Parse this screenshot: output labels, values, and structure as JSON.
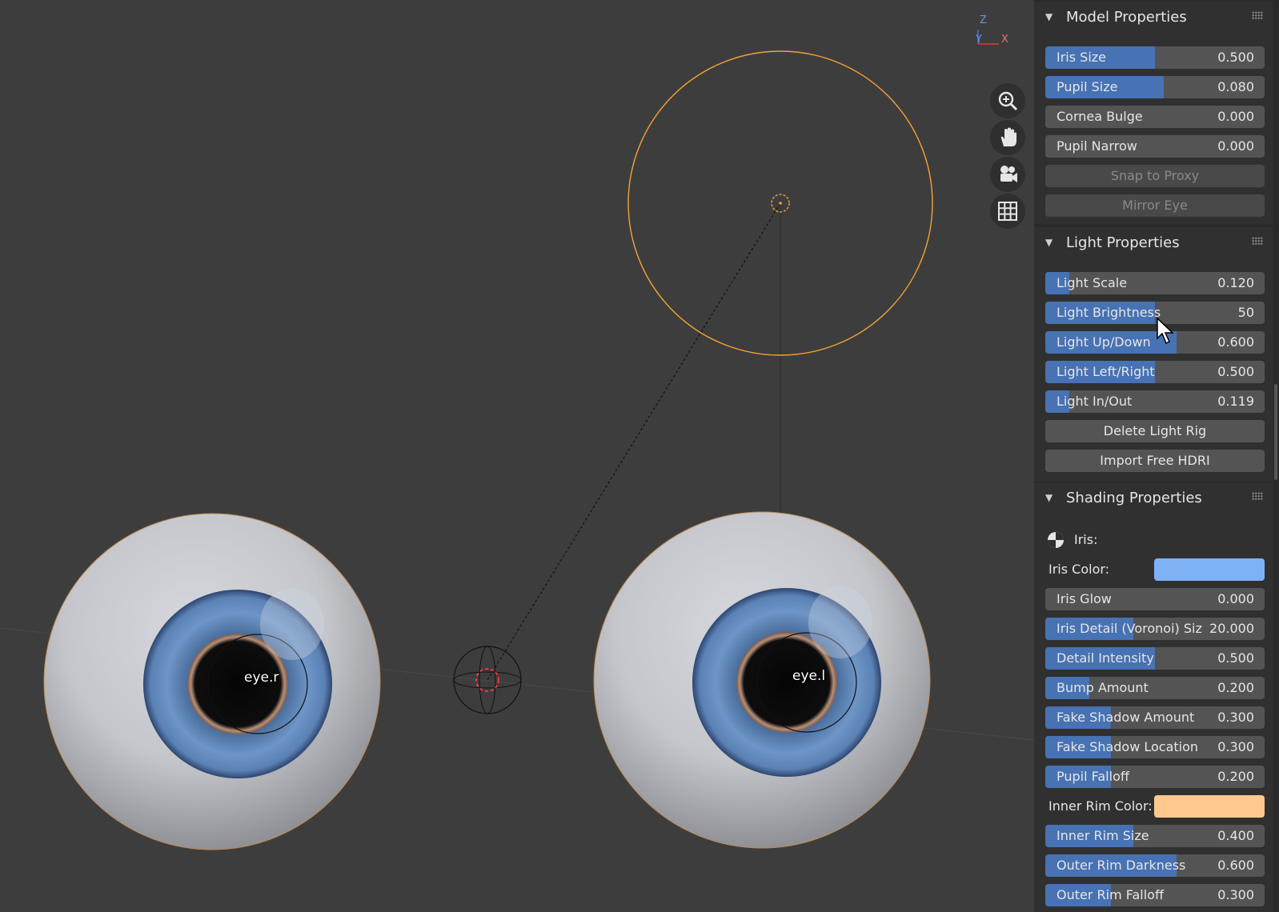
{
  "viewport": {
    "eyes": [
      {
        "label": "eye.r"
      },
      {
        "label": "eye.l"
      }
    ],
    "axes": {
      "z": "Z",
      "y": "Y",
      "x": "X"
    },
    "nav_buttons": [
      {
        "name": "zoom-button",
        "icon": "zoom-in-icon"
      },
      {
        "name": "pan-button",
        "icon": "hand-icon"
      },
      {
        "name": "camera-button",
        "icon": "camera-icon"
      },
      {
        "name": "grid-button",
        "icon": "grid-icon"
      }
    ],
    "colors": {
      "light_outline": "#f5a133",
      "background": "#3d3d3d"
    }
  },
  "panels": {
    "model": {
      "title": "Model Properties",
      "sliders": [
        {
          "label": "Iris Size",
          "value": "0.500",
          "fill": 0.5
        },
        {
          "label": "Pupil Size",
          "value": "0.080",
          "fill": 0.54
        },
        {
          "label": "Cornea Bulge",
          "value": "0.000",
          "fill": 0
        },
        {
          "label": "Pupil Narrow",
          "value": "0.000",
          "fill": 0
        }
      ],
      "buttons": [
        {
          "label": "Snap to Proxy",
          "enabled": false
        },
        {
          "label": "Mirror Eye",
          "enabled": false
        }
      ]
    },
    "light": {
      "title": "Light Properties",
      "sliders": [
        {
          "label": "Light Scale",
          "value": "0.120",
          "fill": 0.11
        },
        {
          "label": "Light Brightness",
          "value": "50",
          "fill": 0.5
        },
        {
          "label": "Light Up/Down",
          "value": "0.600",
          "fill": 0.6
        },
        {
          "label": "Light Left/Right",
          "value": "0.500",
          "fill": 0.5
        },
        {
          "label": "Light In/Out",
          "value": "0.119",
          "fill": 0.11
        }
      ],
      "buttons": [
        {
          "label": "Delete Light Rig",
          "enabled": true
        },
        {
          "label": "Import Free HDRI",
          "enabled": true
        }
      ]
    },
    "shading": {
      "title": "Shading Properties",
      "iris_header": "Iris:",
      "iris_color_label": "Iris Color:",
      "iris_color": "#7fb2f5",
      "sliders_a": [
        {
          "label": "Iris Glow",
          "value": "0.000",
          "fill": 0
        },
        {
          "label": "Iris Detail (Voronoi) Siz",
          "value": "20.000",
          "fill": 0.4
        },
        {
          "label": "Detail Intensity",
          "value": "0.500",
          "fill": 0.5
        },
        {
          "label": "Bump Amount",
          "value": "0.200",
          "fill": 0.2
        },
        {
          "label": "Fake Shadow Amount",
          "value": "0.300",
          "fill": 0.3
        },
        {
          "label": "Fake Shadow Location",
          "value": "0.300",
          "fill": 0.3
        },
        {
          "label": "Pupil Falloff",
          "value": "0.200",
          "fill": 0.3
        }
      ],
      "inner_rim_color_label": "Inner Rim Color:",
      "inner_rim_color": "#fdc98f",
      "sliders_b": [
        {
          "label": "Inner Rim Size",
          "value": "0.400",
          "fill": 0.4
        },
        {
          "label": "Outer Rim Darkness",
          "value": "0.600",
          "fill": 0.6
        },
        {
          "label": "Outer Rim Falloff",
          "value": "0.300",
          "fill": 0.3
        }
      ]
    }
  }
}
